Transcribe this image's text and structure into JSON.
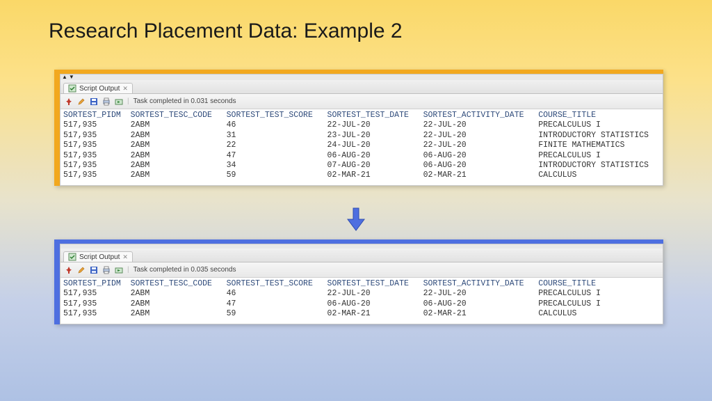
{
  "title": "Research Placement Data: Example 2",
  "tab_label": "Script Output",
  "task_top": "Task completed in 0.031 seconds",
  "task_bottom": "Task completed in 0.035 seconds",
  "columns": [
    "SORTEST_PIDM",
    "SORTEST_TESC_CODE",
    "SORTEST_TEST_SCORE",
    "SORTEST_TEST_DATE",
    "SORTEST_ACTIVITY_DATE",
    "COURSE_TITLE"
  ],
  "rows_top": [
    [
      "517,935",
      "2ABM",
      "46",
      "22-JUL-20",
      "22-JUL-20",
      "PRECALCULUS I"
    ],
    [
      "517,935",
      "2ABM",
      "31",
      "23-JUL-20",
      "22-JUL-20",
      "INTRODUCTORY STATISTICS"
    ],
    [
      "517,935",
      "2ABM",
      "22",
      "24-JUL-20",
      "22-JUL-20",
      "FINITE MATHEMATICS"
    ],
    [
      "517,935",
      "2ABM",
      "47",
      "06-AUG-20",
      "06-AUG-20",
      "PRECALCULUS I"
    ],
    [
      "517,935",
      "2ABM",
      "34",
      "07-AUG-20",
      "06-AUG-20",
      "INTRODUCTORY STATISTICS"
    ],
    [
      "517,935",
      "2ABM",
      "59",
      "02-MAR-21",
      "02-MAR-21",
      "CALCULUS"
    ]
  ],
  "rows_bottom": [
    [
      "517,935",
      "2ABM",
      "46",
      "22-JUL-20",
      "22-JUL-20",
      "PRECALCULUS I"
    ],
    [
      "517,935",
      "2ABM",
      "47",
      "06-AUG-20",
      "06-AUG-20",
      "PRECALCULUS I"
    ],
    [
      "517,935",
      "2ABM",
      "59",
      "02-MAR-21",
      "02-MAR-21",
      "CALCULUS"
    ]
  ]
}
